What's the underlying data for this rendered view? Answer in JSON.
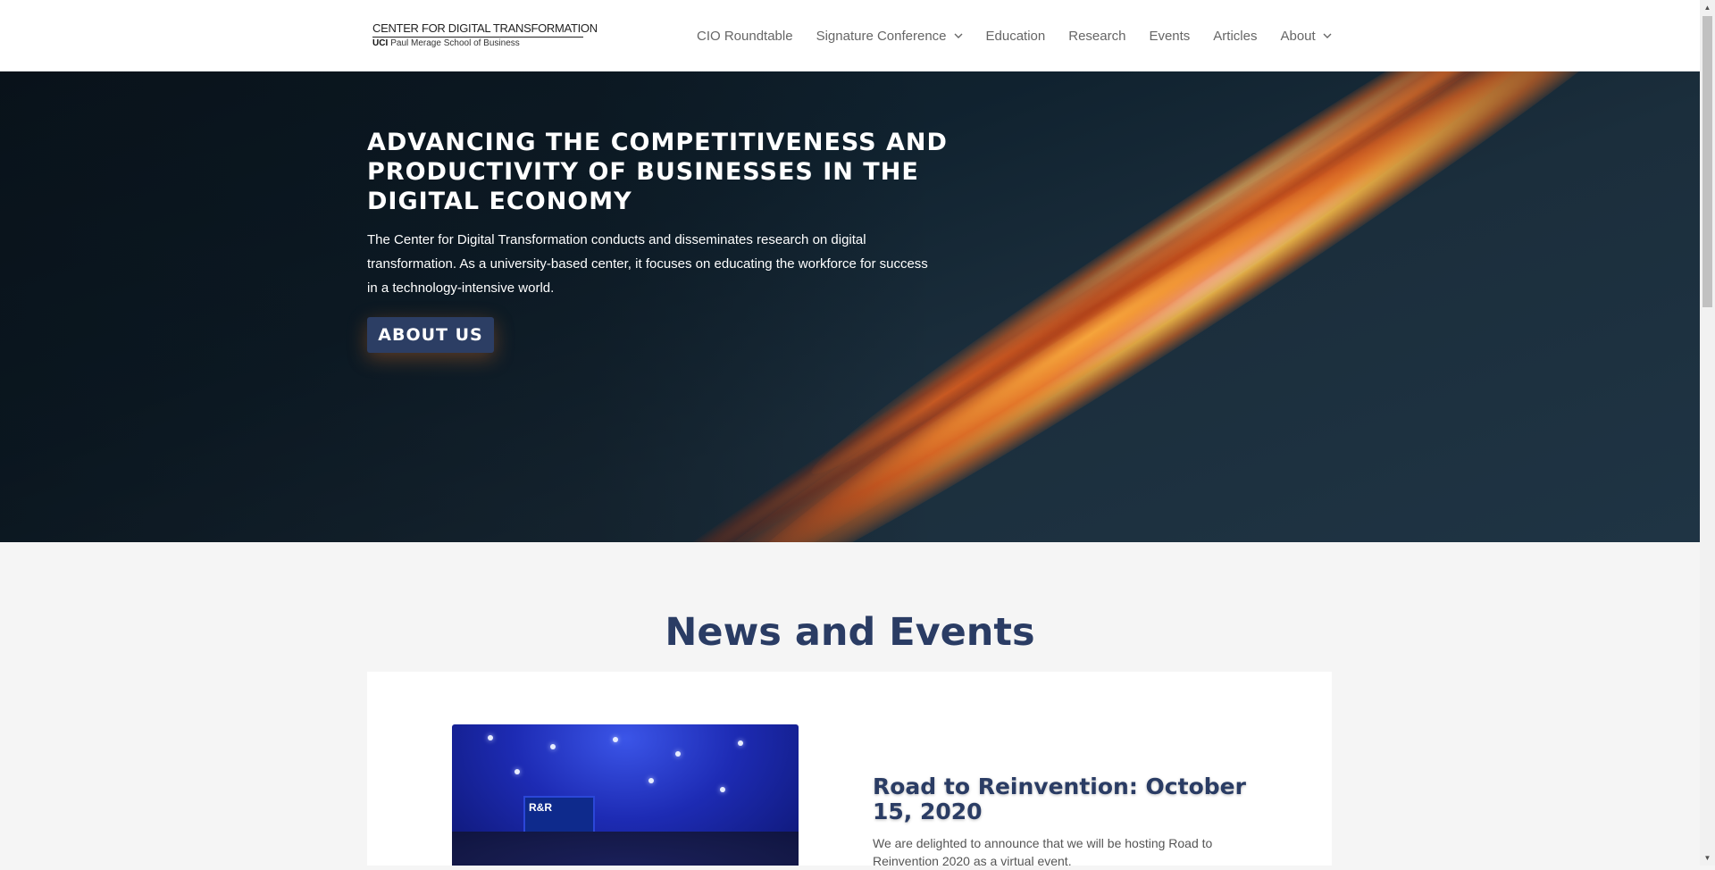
{
  "header": {
    "logo_line1": "CENTER FOR DIGITAL TRANSFORMATION",
    "logo_uci": "UCI",
    "logo_line2": "Paul Merage School of Business",
    "nav": [
      {
        "label": "CIO Roundtable",
        "has_dropdown": false
      },
      {
        "label": "Signature Conference",
        "has_dropdown": true
      },
      {
        "label": "Education",
        "has_dropdown": false
      },
      {
        "label": "Research",
        "has_dropdown": false
      },
      {
        "label": "Events",
        "has_dropdown": false
      },
      {
        "label": "Articles",
        "has_dropdown": false
      },
      {
        "label": "About",
        "has_dropdown": true
      }
    ]
  },
  "hero": {
    "title": "ADVANCING THE COMPETITIVENESS AND PRODUCTIVITY OF BUSINESSES IN THE DIGITAL ECONOMY",
    "text": "The Center for Digital Transformation conducts and disseminates research on digital transformation. As a university-based center, it focuses on educating the workforce for success in a technology-intensive world.",
    "button_label": "ABOUT US"
  },
  "news": {
    "heading": "News and Events",
    "items": [
      {
        "title": "Road to Reinvention: October 15, 2020",
        "text": "We are delighted to announce that we will be hosting Road to Reinvention 2020 as a virtual event.",
        "image_screen_text": "R&R"
      }
    ]
  },
  "colors": {
    "brand_navy": "#2a3c64",
    "button_bg": "#2c3e64",
    "nav_text": "#666666",
    "hero_orange": "#f07a1e"
  },
  "icons": {
    "dropdown": "chevron-down-icon",
    "scroll_up": "arrow-up-icon",
    "scroll_down": "arrow-down-icon"
  }
}
